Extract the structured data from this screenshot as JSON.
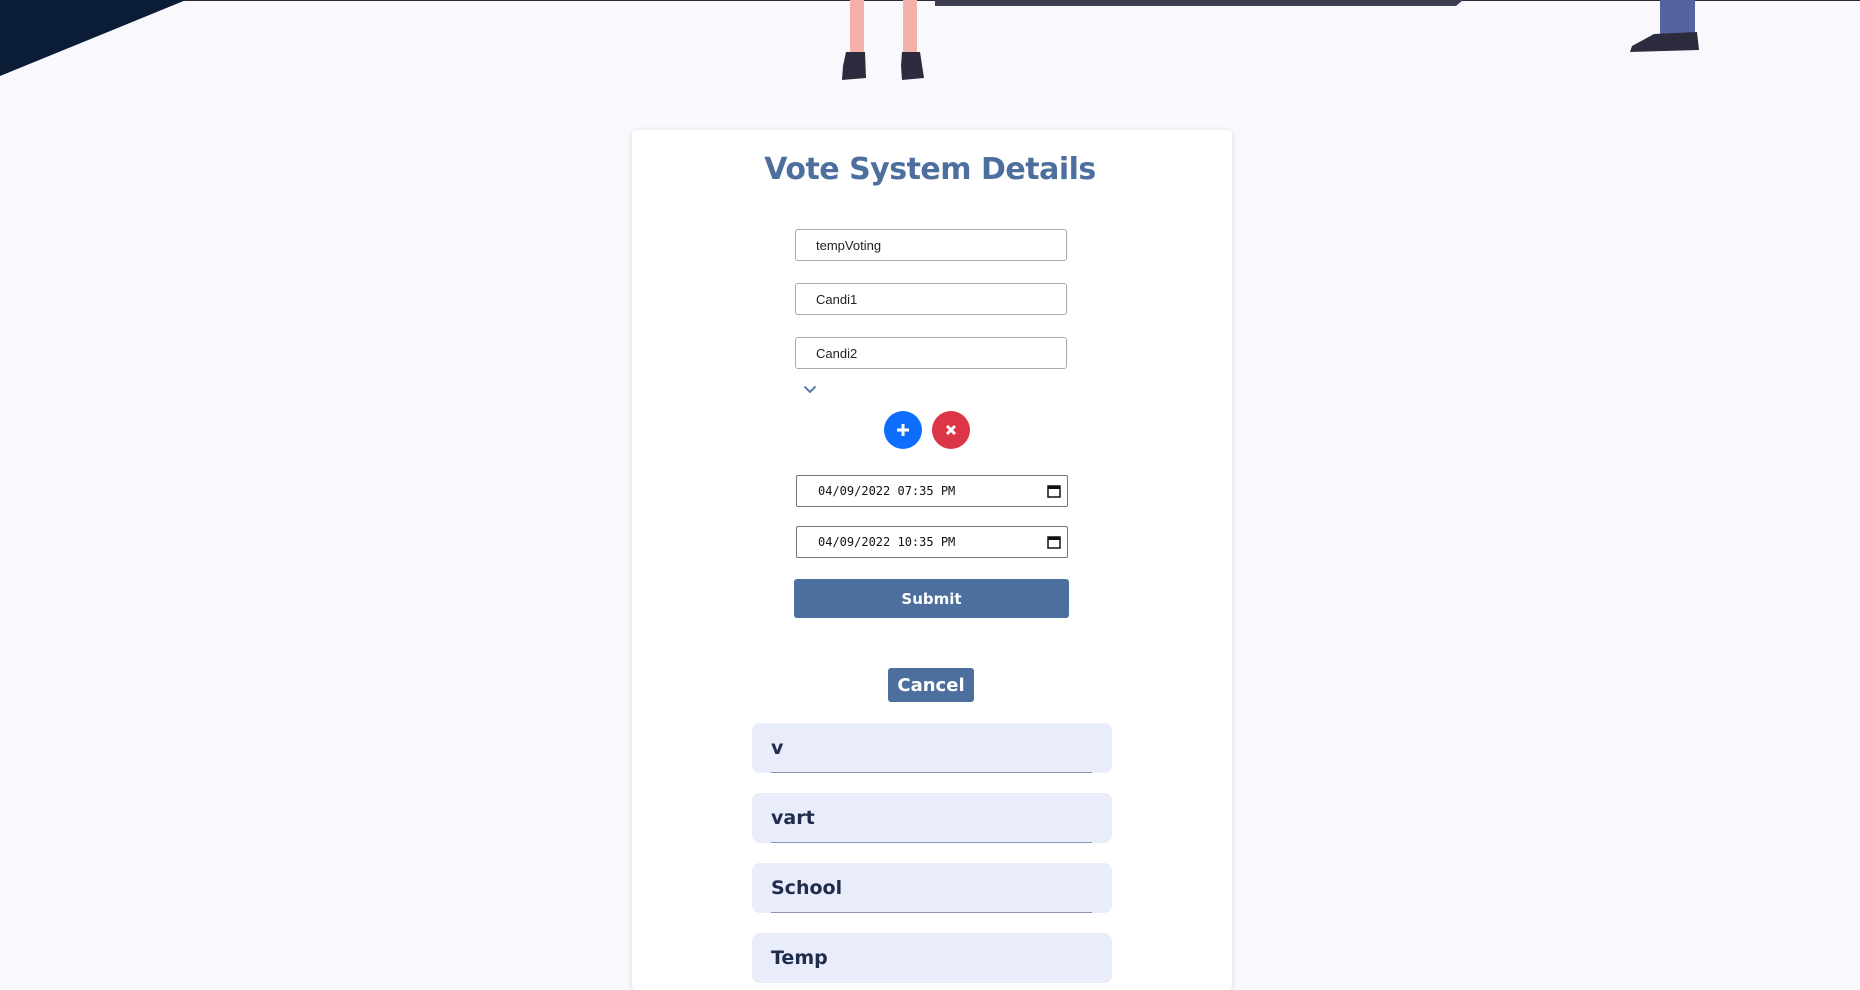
{
  "form": {
    "title": "Vote System Details",
    "vote_name": "tempVoting",
    "candidates": [
      "Candi1",
      "Candi2"
    ],
    "start_datetime": "04/09/2022 07:35 PM",
    "end_datetime": "04/09/2022 10:35 PM",
    "submit_label": "Submit",
    "cancel_label": "Cancel"
  },
  "vote_list": [
    {
      "label": "v"
    },
    {
      "label": "vart"
    },
    {
      "label": "School"
    },
    {
      "label": "Temp"
    }
  ],
  "colors": {
    "accent": "#4d6f9e",
    "add_button": "#0d6efd",
    "remove_button": "#dc3545",
    "list_bg": "#e8ecfb",
    "corner": "#0b1c36"
  },
  "icons": {
    "add": "plus-icon",
    "remove": "close-icon",
    "expand": "chevron-down-icon",
    "calendar": "calendar-icon"
  }
}
